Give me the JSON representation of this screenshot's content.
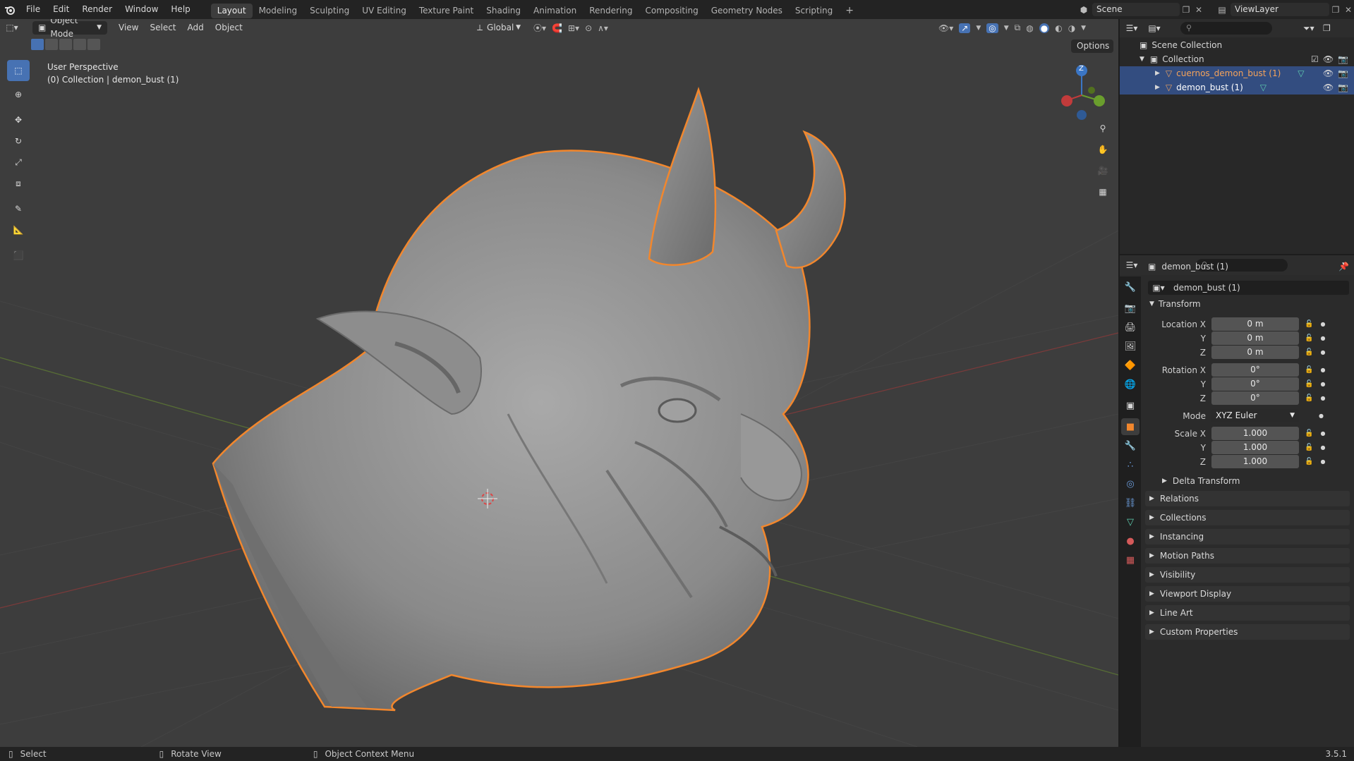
{
  "topbar": {
    "menus": [
      "File",
      "Edit",
      "Render",
      "Window",
      "Help"
    ],
    "workspaces": [
      "Layout",
      "Modeling",
      "Sculpting",
      "UV Editing",
      "Texture Paint",
      "Shading",
      "Animation",
      "Rendering",
      "Compositing",
      "Geometry Nodes",
      "Scripting"
    ],
    "active_workspace": "Layout",
    "scene": "Scene",
    "view_layer": "ViewLayer"
  },
  "viewport_header": {
    "mode": "Object Mode",
    "menus": [
      "View",
      "Select",
      "Add",
      "Object"
    ],
    "orientation": "Global",
    "options": "Options"
  },
  "viewport": {
    "perspective": "User Perspective",
    "collection_info": "(0) Collection | demon_bust (1)",
    "gizmo_axis_label": "Z",
    "accent": "#f2872d"
  },
  "outliner": {
    "scene_collection": "Scene Collection",
    "collection": "Collection",
    "items": [
      {
        "name": "cuernos_demon_bust (1)",
        "color": "#f5a35a"
      },
      {
        "name": "demon_bust (1)",
        "color": "#ffffff"
      }
    ]
  },
  "properties": {
    "object_name": "demon_bust (1)",
    "datablock": "demon_bust (1)",
    "transform_label": "Transform",
    "location": {
      "label": "Location X",
      "x": "0 m",
      "y": "0 m",
      "z": "0 m"
    },
    "rotation": {
      "label": "Rotation X",
      "x": "0°",
      "y": "0°",
      "z": "0°"
    },
    "mode_label": "Mode",
    "mode_value": "XYZ Euler",
    "scale": {
      "label": "Scale X",
      "x": "1.000",
      "y": "1.000",
      "z": "1.000"
    },
    "axis_y": "Y",
    "axis_z": "Z",
    "delta_transform": "Delta Transform",
    "panels": [
      "Relations",
      "Collections",
      "Instancing",
      "Motion Paths",
      "Visibility",
      "Viewport Display",
      "Line Art",
      "Custom Properties"
    ]
  },
  "statusbar": {
    "select": "Select",
    "rotate": "Rotate View",
    "context": "Object Context Menu",
    "version": "3.5.1"
  }
}
